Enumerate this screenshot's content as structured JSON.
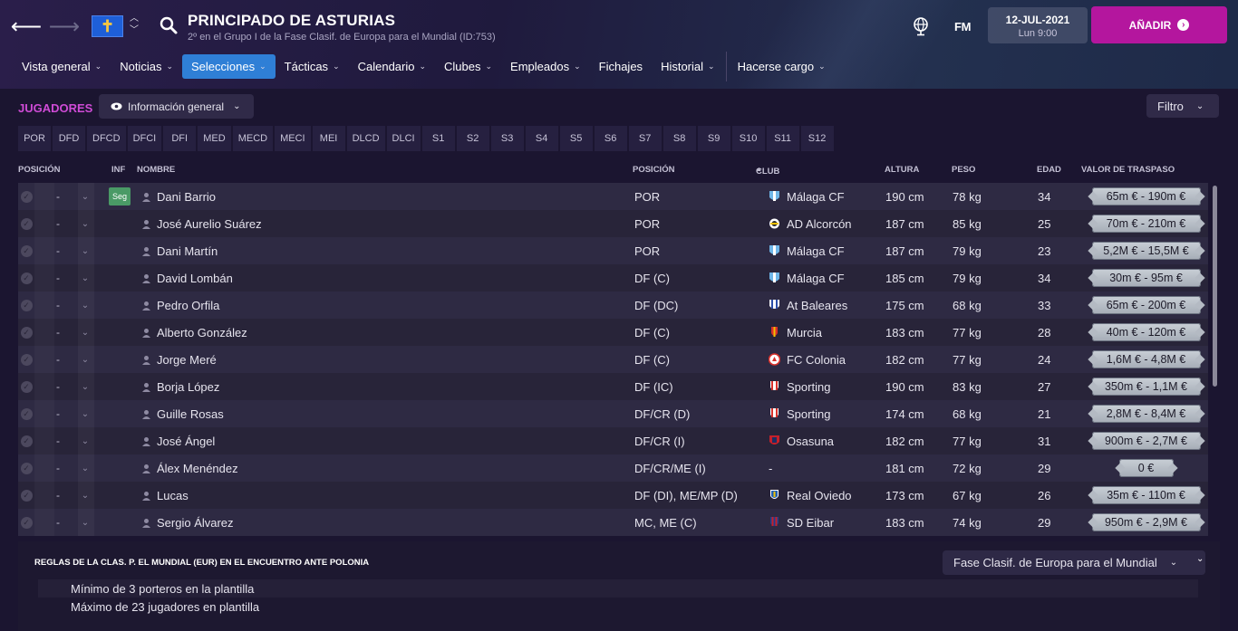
{
  "header": {
    "team_name": "PRINCIPADO DE ASTURIAS",
    "team_subtitle": "2º en el Grupo I de la Fase Clasif. de Europa para el Mundial (ID:753)",
    "flag_symbol": "✝",
    "logo_text": "FM",
    "date": "12-JUL-2021",
    "day_time": "Lun 9:00",
    "add_button": "AÑADIR",
    "accent_color": "#b4169e"
  },
  "menu": [
    {
      "label": "Vista general",
      "chevron": "⌄"
    },
    {
      "label": "Noticias",
      "chevron": "⌄"
    },
    {
      "label": "Selecciones",
      "chevron": "⌄"
    },
    {
      "label": "Tácticas",
      "chevron": "⌄"
    },
    {
      "label": "Calendario",
      "chevron": "⌄"
    },
    {
      "label": "Clubes",
      "chevron": "⌄"
    },
    {
      "label": "Empleados",
      "chevron": "⌄"
    },
    {
      "label": "Fichajes",
      "chevron": ""
    },
    {
      "label": "Historial",
      "chevron": "⌄"
    },
    {
      "label": "Hacerse cargo",
      "chevron": "⌄"
    }
  ],
  "section": {
    "title": "JUGADORES",
    "view_select": "Información general",
    "filter": "Filtro"
  },
  "position_tabs": [
    "POR",
    "DFD",
    "DFCD",
    "DFCI",
    "DFI",
    "MED",
    "MECD",
    "MECI",
    "MEI",
    "DLCD",
    "DLCI",
    "S1",
    "S2",
    "S3",
    "S4",
    "S5",
    "S6",
    "S7",
    "S8",
    "S9",
    "S10",
    "S11",
    "S12"
  ],
  "table": {
    "headers": {
      "posicion_l": "POSICIÓN",
      "inf": "INF",
      "nombre": "NOMBRE",
      "posicion": "POSICIÓN",
      "club": "CLUB",
      "altura": "ALTURA",
      "peso": "PESO",
      "edad": "EDAD",
      "valor": "VALOR DE TRASPASO"
    },
    "rows": [
      {
        "status": "-",
        "inf": "Seg",
        "name": "Dani Barrio",
        "position": "POR",
        "club": "Málaga CF",
        "height": "190 cm",
        "weight": "78 kg",
        "age": "34",
        "value": "65m € - 190m €"
      },
      {
        "status": "-",
        "inf": "",
        "name": "José Aurelio Suárez",
        "position": "POR",
        "club": "AD Alcorcón",
        "height": "187 cm",
        "weight": "85 kg",
        "age": "25",
        "value": "70m € - 210m €"
      },
      {
        "status": "-",
        "inf": "",
        "name": "Dani Martín",
        "position": "POR",
        "club": "Málaga CF",
        "height": "187 cm",
        "weight": "79 kg",
        "age": "23",
        "value": "5,2M € - 15,5M €"
      },
      {
        "status": "-",
        "inf": "",
        "name": "David Lombán",
        "position": "DF (C)",
        "club": "Málaga CF",
        "height": "185 cm",
        "weight": "79 kg",
        "age": "34",
        "value": "30m € - 95m €"
      },
      {
        "status": "-",
        "inf": "",
        "name": "Pedro Orfila",
        "position": "DF (DC)",
        "club": "At Baleares",
        "height": "175 cm",
        "weight": "68 kg",
        "age": "33",
        "value": "65m € - 200m €"
      },
      {
        "status": "-",
        "inf": "",
        "name": "Alberto González",
        "position": "DF (C)",
        "club": "Murcia",
        "height": "183 cm",
        "weight": "77 kg",
        "age": "28",
        "value": "40m € - 120m €"
      },
      {
        "status": "-",
        "inf": "",
        "name": "Jorge Meré",
        "position": "DF (C)",
        "club": "FC Colonia",
        "height": "182 cm",
        "weight": "77 kg",
        "age": "24",
        "value": "1,6M € - 4,8M €"
      },
      {
        "status": "-",
        "inf": "",
        "name": "Borja López",
        "position": "DF (IC)",
        "club": "Sporting",
        "height": "190 cm",
        "weight": "83 kg",
        "age": "27",
        "value": "350m € - 1,1M €"
      },
      {
        "status": "-",
        "inf": "",
        "name": "Guille Rosas",
        "position": "DF/CR (D)",
        "club": "Sporting",
        "height": "174 cm",
        "weight": "68 kg",
        "age": "21",
        "value": "2,8M € - 8,4M €"
      },
      {
        "status": "-",
        "inf": "",
        "name": "José Ángel",
        "position": "DF/CR (I)",
        "club": "Osasuna",
        "height": "182 cm",
        "weight": "77 kg",
        "age": "31",
        "value": "900m € - 2,7M €"
      },
      {
        "status": "-",
        "inf": "",
        "name": "Álex Menéndez",
        "position": "DF/CR/ME (I)",
        "club": "-",
        "height": "181 cm",
        "weight": "72 kg",
        "age": "29",
        "value": "0 €"
      },
      {
        "status": "-",
        "inf": "",
        "name": "Lucas",
        "position": "DF (DI), ME/MP (D)",
        "club": "Real Oviedo",
        "height": "173 cm",
        "weight": "67 kg",
        "age": "26",
        "value": "35m € - 110m €"
      },
      {
        "status": "-",
        "inf": "",
        "name": "Sergio Álvarez",
        "position": "MC, ME (C)",
        "club": "SD Eibar",
        "height": "183 cm",
        "weight": "74 kg",
        "age": "29",
        "value": "950m € - 2,9M €"
      }
    ]
  },
  "rules": {
    "title": "REGLAS DE LA CLAS. P. EL MUNDIAL (EUR) EN EL ENCUENTRO ANTE POLONIA",
    "competition_select": "Fase Clasif. de Europa para el Mundial",
    "lines": [
      "Mínimo de 3 porteros en la plantilla",
      "Máximo de 23 jugadores en plantilla"
    ]
  }
}
